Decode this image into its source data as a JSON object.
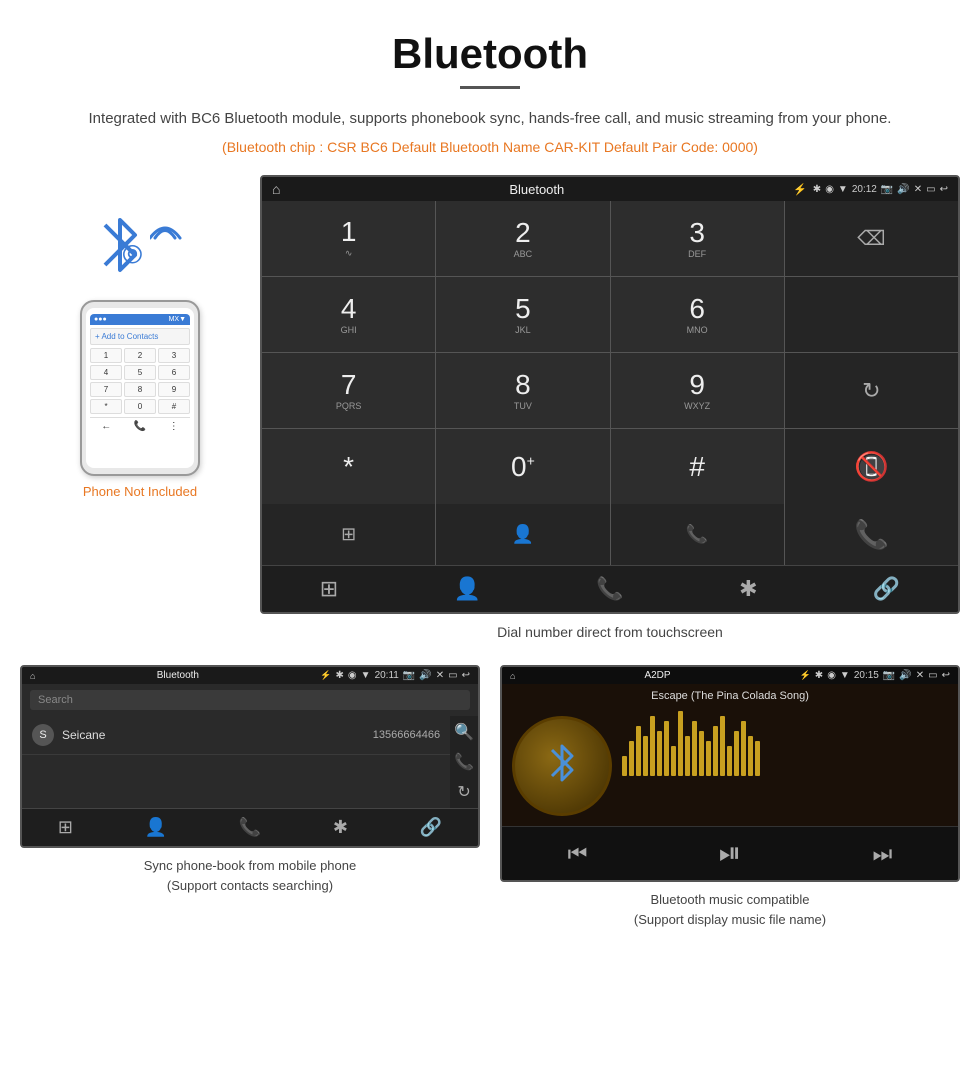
{
  "header": {
    "title": "Bluetooth",
    "description": "Integrated with BC6 Bluetooth module, supports phonebook sync, hands-free call, and music streaming from your phone.",
    "orange_text": "(Bluetooth chip : CSR BC6    Default Bluetooth Name CAR-KIT    Default Pair Code: 0000)"
  },
  "dialpad_screen": {
    "status_bar": {
      "title": "Bluetooth",
      "time": "20:12"
    },
    "keys": [
      {
        "num": "1",
        "letters": ""
      },
      {
        "num": "2",
        "letters": "ABC"
      },
      {
        "num": "3",
        "letters": "DEF"
      },
      {
        "num": "",
        "letters": "",
        "special": "backspace"
      },
      {
        "num": "4",
        "letters": "GHI"
      },
      {
        "num": "5",
        "letters": "JKL"
      },
      {
        "num": "6",
        "letters": "MNO"
      },
      {
        "num": "",
        "letters": "",
        "special": "empty"
      },
      {
        "num": "7",
        "letters": "PQRS"
      },
      {
        "num": "8",
        "letters": "TUV"
      },
      {
        "num": "9",
        "letters": "WXYZ"
      },
      {
        "num": "",
        "letters": "",
        "special": "refresh"
      },
      {
        "num": "*",
        "letters": ""
      },
      {
        "num": "0",
        "letters": "+",
        "superscript": true
      },
      {
        "num": "#",
        "letters": ""
      },
      {
        "num": "",
        "letters": "",
        "special": "green-call"
      }
    ],
    "caption": "Dial number direct from touchscreen"
  },
  "phonebook_screen": {
    "status_bar": {
      "title": "Bluetooth",
      "time": "20:11"
    },
    "search_placeholder": "Search",
    "contacts": [
      {
        "letter": "S",
        "name": "Seicane",
        "number": "13566664466"
      }
    ],
    "caption": "Sync phone-book from mobile phone\n(Support contacts searching)"
  },
  "music_screen": {
    "status_bar": {
      "title": "A2DP",
      "time": "20:15"
    },
    "song_title": "Escape (The Pina Colada Song)",
    "visualizer_bars": [
      20,
      35,
      50,
      40,
      60,
      45,
      55,
      30,
      65,
      40,
      55,
      45,
      35,
      50,
      60,
      30,
      45,
      55,
      40,
      35
    ],
    "caption": "Bluetooth music compatible\n(Support display music file name)"
  },
  "phone_section": {
    "not_included_label": "Phone Not Included"
  }
}
